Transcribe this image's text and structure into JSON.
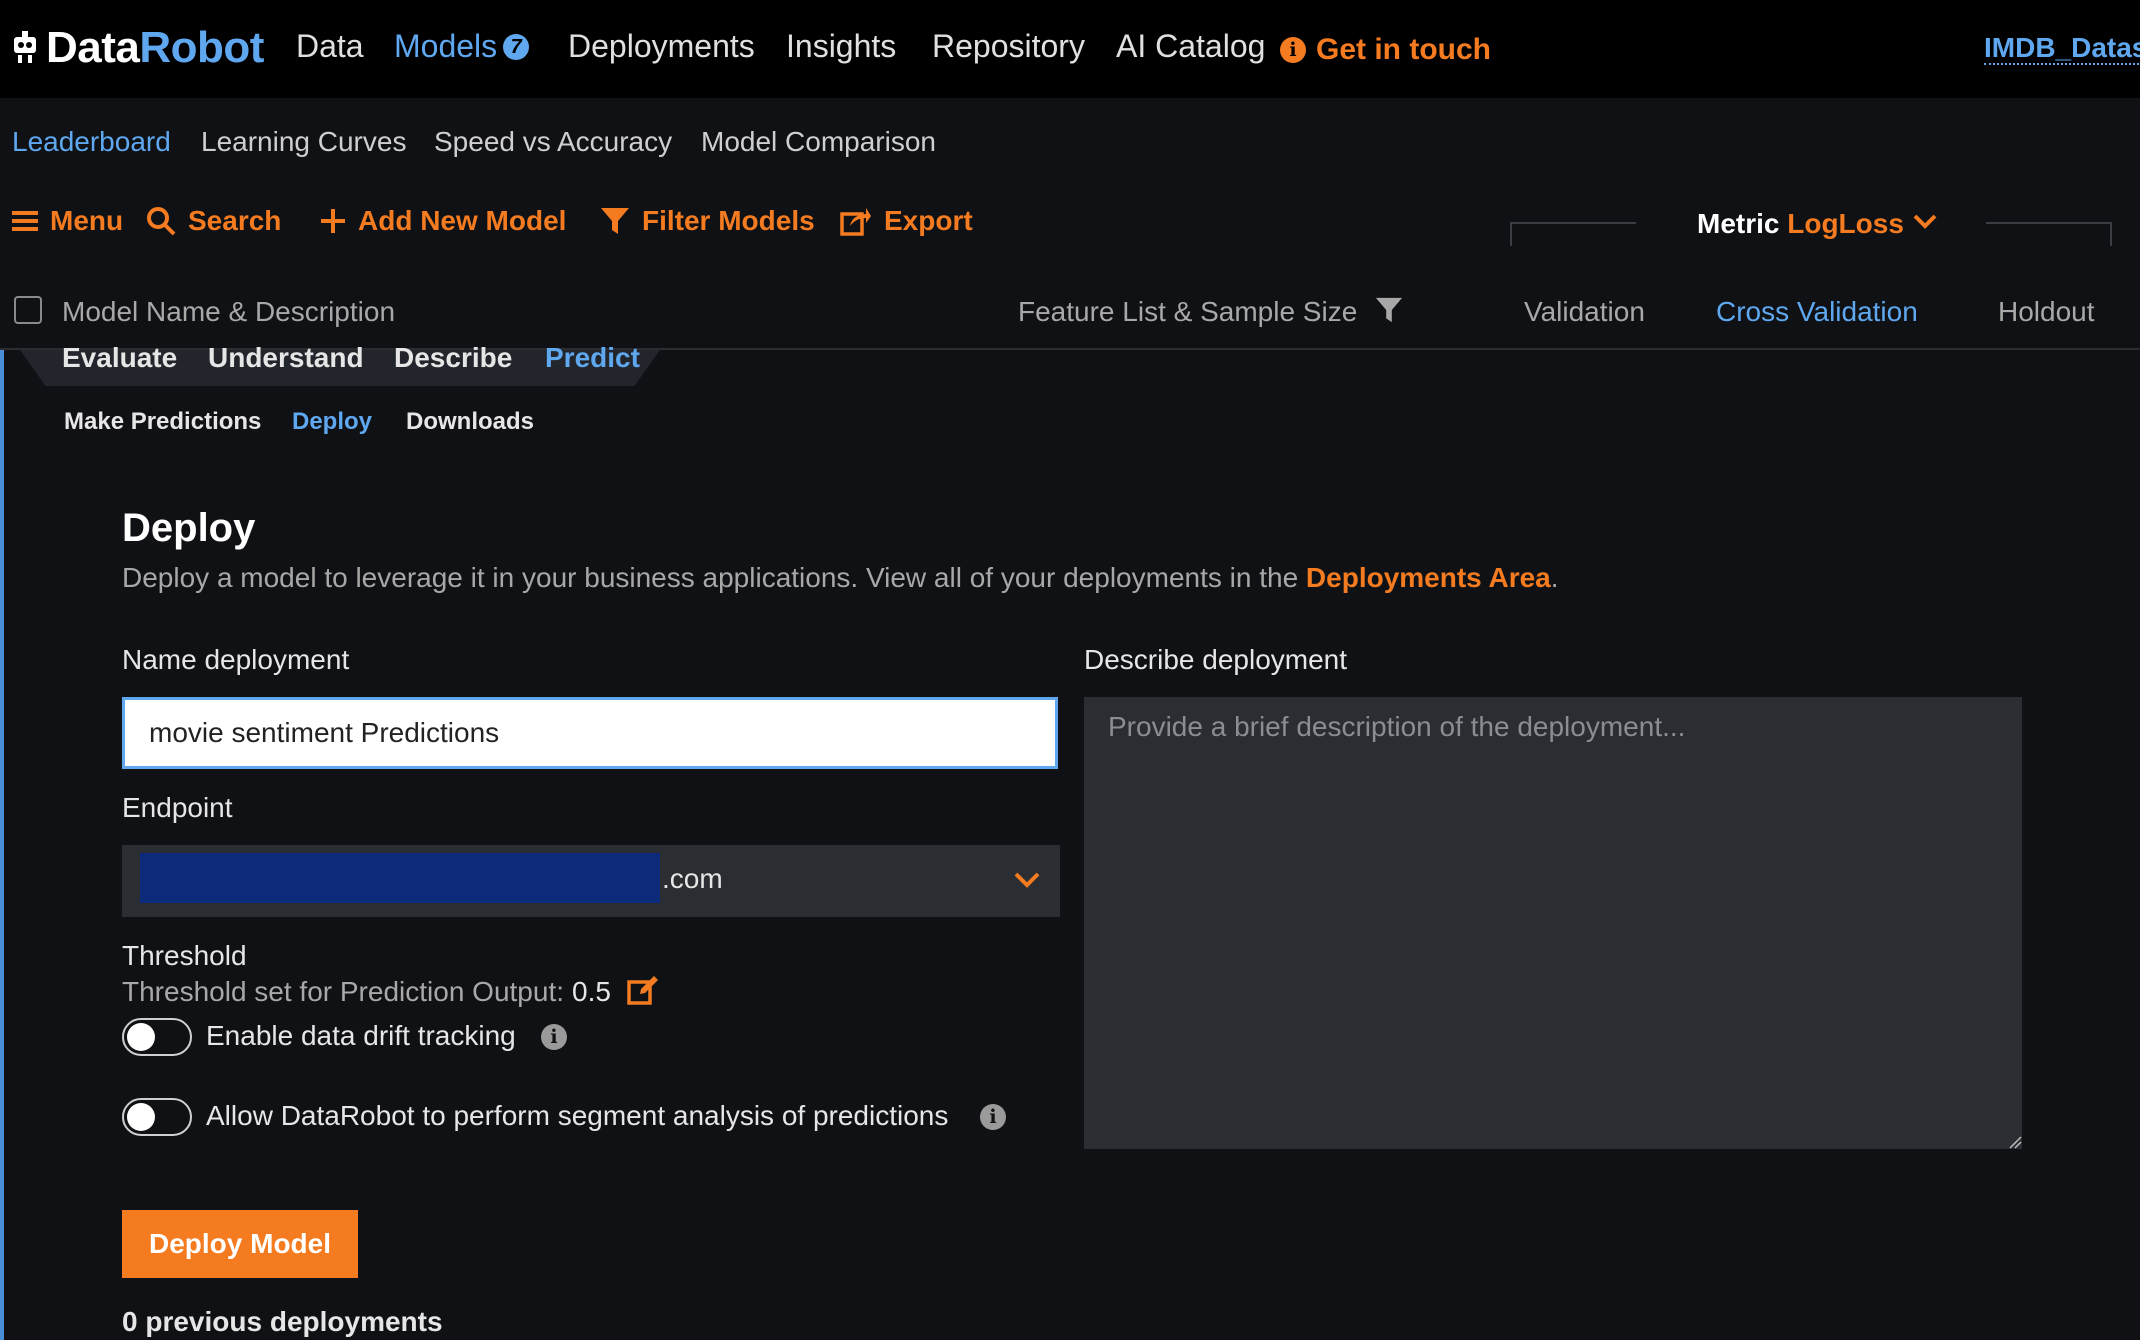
{
  "app": {
    "logo_data": "Data",
    "logo_robot": "Robot"
  },
  "topnav": {
    "items": [
      "Data",
      "Models",
      "Deployments",
      "Insights",
      "Repository",
      "AI Catalog"
    ],
    "models_badge": "7",
    "get_in_touch": "Get in touch",
    "dataset": "IMDB_Datas"
  },
  "subtabs": [
    "Leaderboard",
    "Learning Curves",
    "Speed vs Accuracy",
    "Model Comparison"
  ],
  "toolbar": {
    "menu": "Menu",
    "search": "Search",
    "add_new_model": "Add New Model",
    "filter_models": "Filter Models",
    "export": "Export",
    "metric_label": "Metric",
    "metric_value": "LogLoss"
  },
  "columns": {
    "model_name": "Model Name & Description",
    "feature_list": "Feature List & Sample Size",
    "validation": "Validation",
    "cross_validation": "Cross Validation",
    "holdout": "Holdout"
  },
  "model_tabs": [
    "Evaluate",
    "Understand",
    "Describe",
    "Predict"
  ],
  "predict_subtabs": [
    "Make Predictions",
    "Deploy",
    "Downloads"
  ],
  "deploy": {
    "title": "Deploy",
    "description": "Deploy a model to leverage it in your business applications. View all of your deployments in the ",
    "description_link": "Deployments Area",
    "description_end": ".",
    "name_label": "Name deployment",
    "name_value": "movie sentiment Predictions",
    "describe_label": "Describe deployment",
    "describe_placeholder": "Provide a brief description of the deployment...",
    "endpoint_label": "Endpoint",
    "endpoint_value": ".com",
    "threshold_label": "Threshold",
    "threshold_sub": "Threshold set for Prediction Output:",
    "threshold_value": "0.5",
    "drift_label": "Enable data drift tracking",
    "segment_label": "Allow DataRobot to perform segment analysis of predictions",
    "deploy_button": "Deploy Model",
    "previous": "0 previous deployments"
  },
  "colors": {
    "accent_orange": "#f47b20",
    "accent_blue": "#5fa8f0",
    "background": "#0f1115"
  }
}
